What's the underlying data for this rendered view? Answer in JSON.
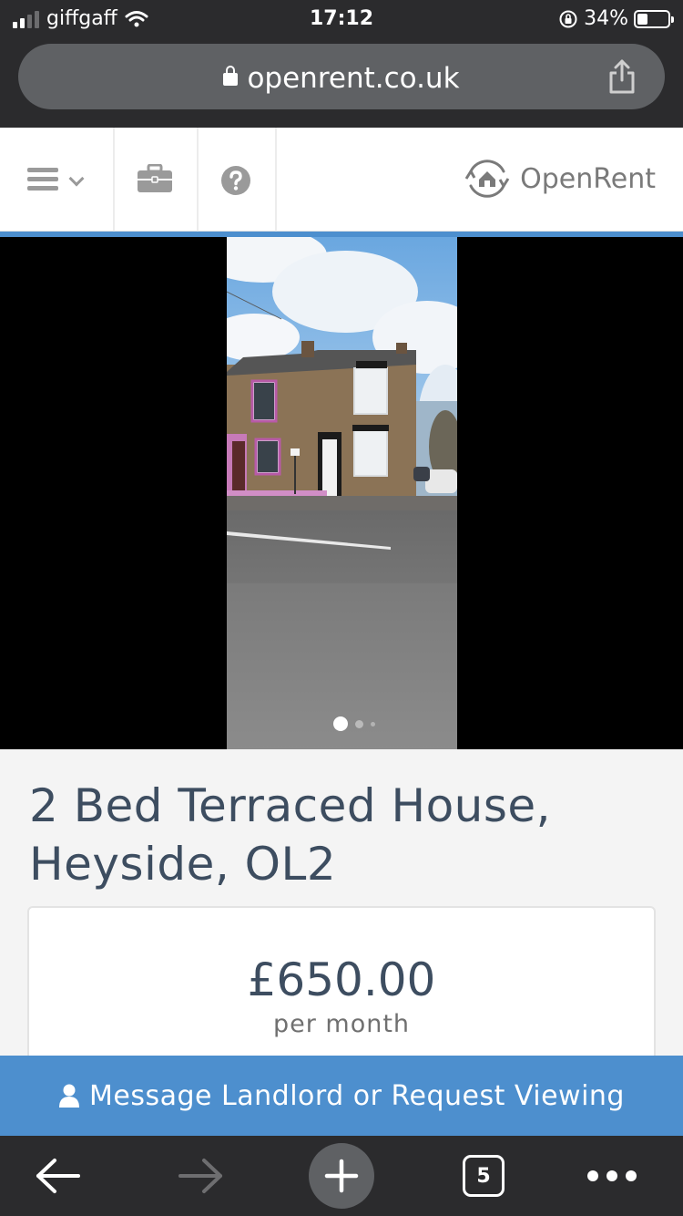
{
  "status_bar": {
    "carrier": "giffgaff",
    "time": "17:12",
    "battery_percent": "34%",
    "battery_level": 0.34
  },
  "browser": {
    "url": "openrent.co.uk",
    "tab_count": "5"
  },
  "site_header": {
    "logo_text": "OpenRent",
    "icons": [
      "menu-icon",
      "briefcase-icon",
      "help-icon",
      "openrent-logo-icon"
    ]
  },
  "gallery": {
    "image_count": 3,
    "active_index": 0
  },
  "listing": {
    "title": "2 Bed Terraced House, Heyside, OL2",
    "price": "£650.00",
    "price_period": "per month"
  },
  "cta": {
    "label": "Message Landlord or Request Viewing"
  },
  "colors": {
    "brand_blue": "#4d8fce",
    "text_navy": "#3d4d60",
    "browser_chrome": "#2b2b2d"
  }
}
